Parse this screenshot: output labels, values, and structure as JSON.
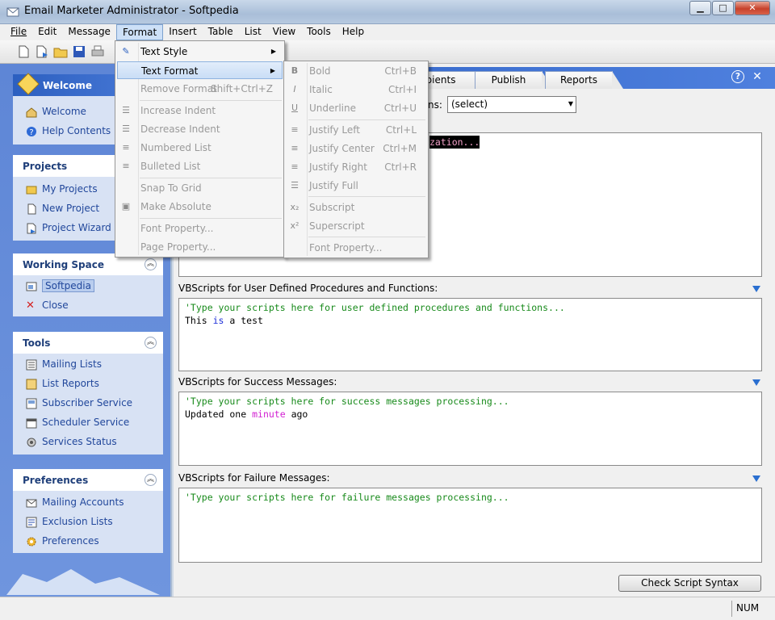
{
  "window": {
    "title": "Email Marketer Administrator - Softpedia",
    "minimize": "▁",
    "maximize": "□",
    "close": "✕"
  },
  "menubar": [
    "File",
    "Edit",
    "Message",
    "Format",
    "Insert",
    "Table",
    "List",
    "View",
    "Tools",
    "Help"
  ],
  "sidebar": {
    "welcome": {
      "title": "Welcome",
      "items": [
        "Welcome",
        "Help Contents"
      ]
    },
    "projects": {
      "title": "Projects",
      "items": [
        "My Projects",
        "New Project",
        "Project Wizard"
      ]
    },
    "working_space": {
      "title": "Working Space",
      "items": [
        "Softpedia",
        "Close"
      ]
    },
    "tools": {
      "title": "Tools",
      "items": [
        "Mailing Lists",
        "List Reports",
        "Subscriber Service",
        "Scheduler Service",
        "Services Status"
      ]
    },
    "preferences": {
      "title": "Preferences",
      "items": [
        "Mailing Accounts",
        "Exclusion Lists",
        "Preferences"
      ]
    }
  },
  "tabs": [
    "pients",
    "Publish",
    "Reports"
  ],
  "main": {
    "functions_label": "ns:",
    "functions_value": "(select)",
    "init_code": "zation...",
    "section1_label": "VBScripts for User Defined Procedures and Functions:",
    "section1_comment": "'Type your scripts here for user defined procedures and functions...",
    "section1_line2": {
      "a": "This ",
      "kw": "is",
      "b": " a test"
    },
    "section2_label": "VBScripts for Success Messages:",
    "section2_comment": "'Type your scripts here for success messages processing...",
    "section2_line2": {
      "a": "Updated one ",
      "fn": "minute",
      "b": " ago"
    },
    "section3_label": "VBScripts for Failure Messages:",
    "section3_comment": "'Type your scripts here for failure messages processing...",
    "check_button": "Check Script Syntax"
  },
  "format_menu": [
    {
      "label": "Text Style",
      "submenu": true,
      "enabled": true
    },
    {
      "label": "Text Format",
      "submenu": true,
      "enabled": true,
      "highlighted": true
    },
    {
      "label": "Remove Format",
      "shortcut": "Shift+Ctrl+Z"
    },
    {
      "label": "Increase Indent"
    },
    {
      "label": "Decrease Indent"
    },
    {
      "label": "Numbered List"
    },
    {
      "label": "Bulleted List"
    },
    {
      "label": "Snap To Grid"
    },
    {
      "label": "Make Absolute"
    },
    {
      "label": "Font Property..."
    },
    {
      "label": "Page Property..."
    }
  ],
  "text_format_menu": [
    {
      "label": "Bold",
      "shortcut": "Ctrl+B",
      "icon": "B"
    },
    {
      "label": "Italic",
      "shortcut": "Ctrl+I",
      "icon": "I"
    },
    {
      "label": "Underline",
      "shortcut": "Ctrl+U",
      "icon": "U"
    },
    {
      "label": "Justify Left",
      "shortcut": "Ctrl+L"
    },
    {
      "label": "Justify Center",
      "shortcut": "Ctrl+M"
    },
    {
      "label": "Justify Right",
      "shortcut": "Ctrl+R"
    },
    {
      "label": "Justify Full"
    },
    {
      "label": "Subscript",
      "icon": "x₂"
    },
    {
      "label": "Superscript",
      "icon": "x²"
    },
    {
      "label": "Font Property..."
    }
  ],
  "statusbar": {
    "num": "NUM"
  },
  "colors": {
    "sidebar_bg": "#6a90dc",
    "header_blue": "#2d61c4",
    "comment_green": "#178a1a"
  }
}
